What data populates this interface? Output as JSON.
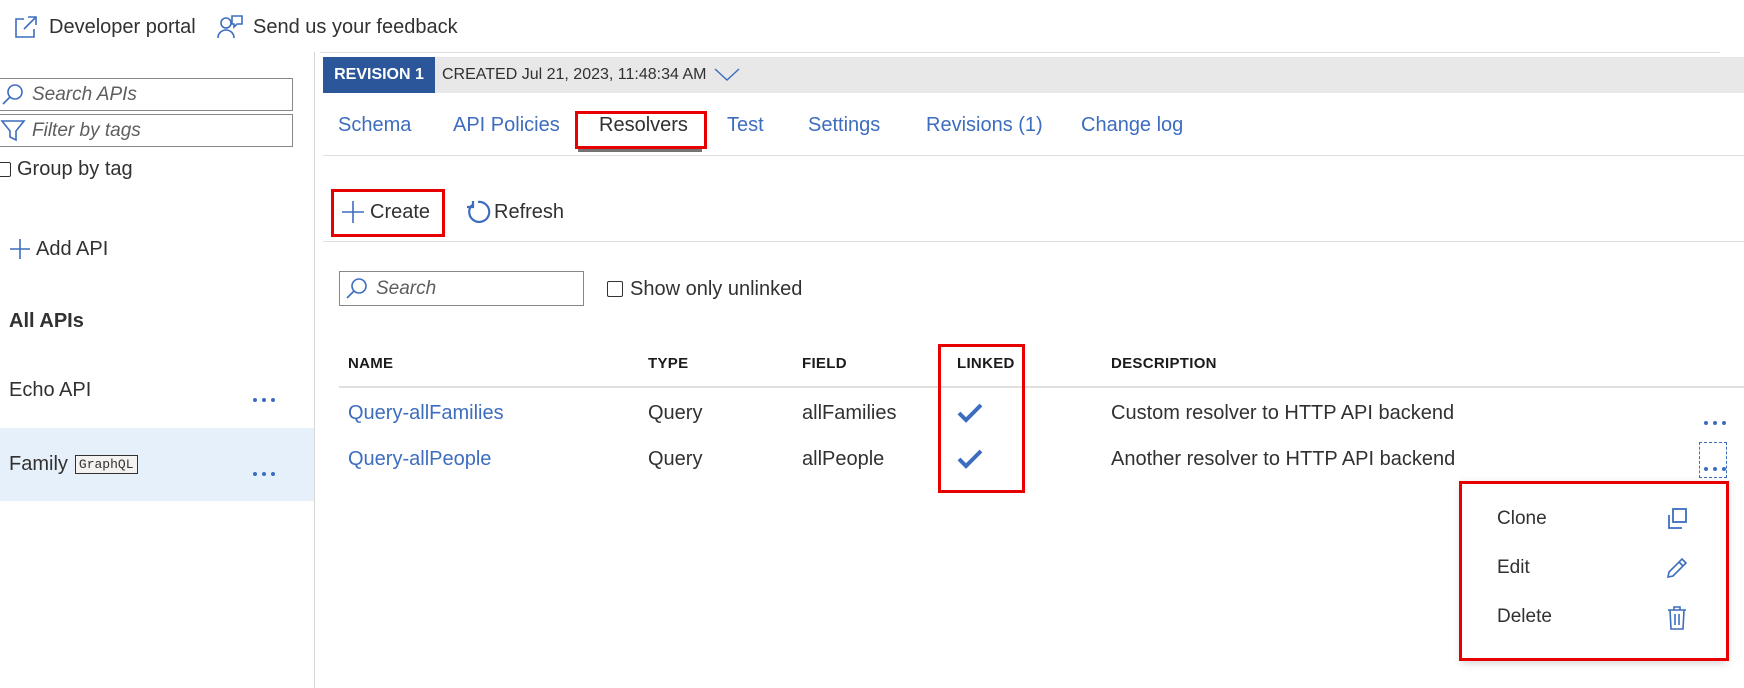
{
  "topbar": {
    "developer_portal": "Developer portal",
    "feedback": "Send us your feedback"
  },
  "sidebar": {
    "search_placeholder": "Search APIs",
    "filter_placeholder": "Filter by tags",
    "group_by_tag": "Group by tag",
    "add_api": "Add API",
    "all_apis_heading": "All APIs",
    "apis": [
      {
        "name": "Echo API",
        "badge": ""
      },
      {
        "name": "Family",
        "badge": "GraphQL",
        "selected": true
      }
    ]
  },
  "revision": {
    "tag": "REVISION 1",
    "created": "CREATED Jul 21, 2023, 11:48:34 AM"
  },
  "tabs": [
    "Schema",
    "API Policies",
    "Resolvers",
    "Test",
    "Settings",
    "Revisions (1)",
    "Change log"
  ],
  "active_tab": "Resolvers",
  "toolbar": {
    "create": "Create",
    "refresh": "Refresh"
  },
  "filter": {
    "search_placeholder": "Search",
    "show_unlinked": "Show only unlinked"
  },
  "table": {
    "headers": [
      "NAME",
      "TYPE",
      "FIELD",
      "LINKED",
      "DESCRIPTION"
    ],
    "rows": [
      {
        "name": "Query-allFamilies",
        "type": "Query",
        "field": "allFamilies",
        "linked": true,
        "description": "Custom resolver to HTTP API backend"
      },
      {
        "name": "Query-allPeople",
        "type": "Query",
        "field": "allPeople",
        "linked": true,
        "description": "Another resolver to HTTP API backend"
      }
    ]
  },
  "context_menu": {
    "items": [
      {
        "label": "Clone",
        "icon": "clone-icon"
      },
      {
        "label": "Edit",
        "icon": "pencil-icon"
      },
      {
        "label": "Delete",
        "icon": "trash-icon"
      }
    ]
  },
  "colors": {
    "accent": "#3d6dbf",
    "revision_tag": "#2b579a",
    "highlight": "#e60000",
    "selected_row": "#e6f0fa"
  }
}
